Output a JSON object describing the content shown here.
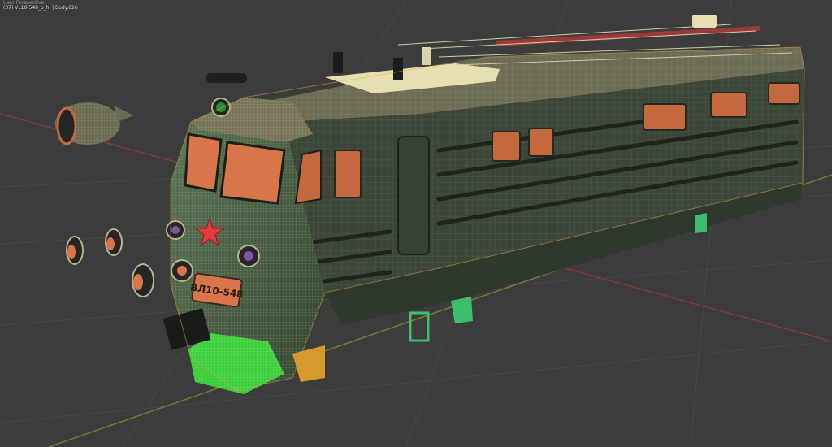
{
  "viewport": {
    "view_label": "User Perspective",
    "object_info": "(37) VL10-548_b_hi | Body.026"
  },
  "loco": {
    "number_plate": "ВЛ10-548"
  },
  "colors": {
    "background": "#3c3c3c",
    "body_green": "#3d4a3a",
    "cab_green": "#4f6a4b",
    "wire": "#c9c7a5",
    "window_orange": "#d8754a",
    "selected_green": "#39e63c",
    "x_axis": "#b44040",
    "y_axis": "#8a8a2e",
    "star_red": "#e0393e"
  }
}
